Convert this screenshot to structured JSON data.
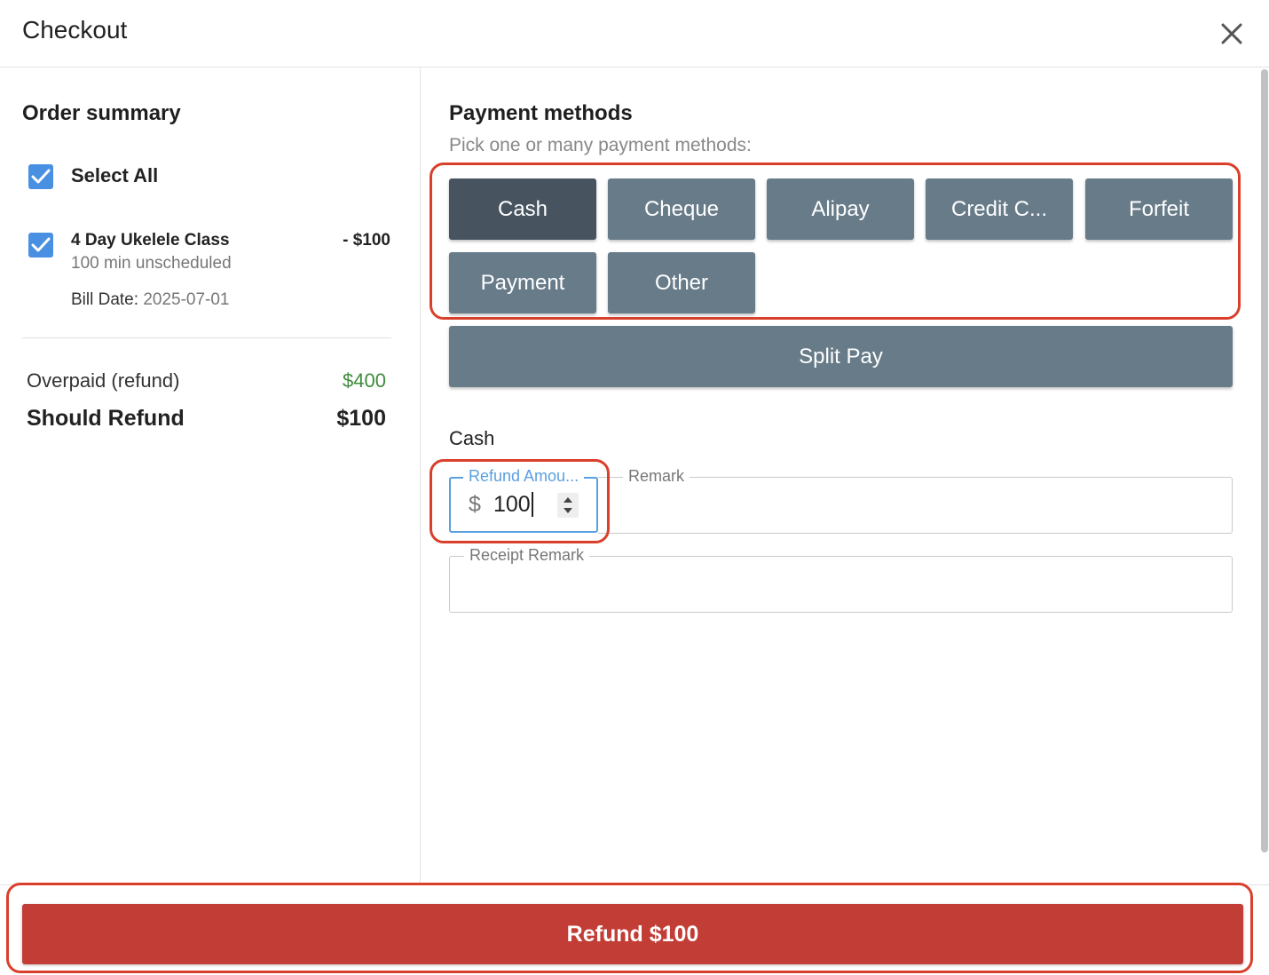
{
  "header": {
    "title": "Checkout"
  },
  "order_summary": {
    "title": "Order summary",
    "select_all_label": "Select All",
    "items": [
      {
        "name": "4 Day Ukelele Class",
        "price": "- $100",
        "sub": "100 min unscheduled",
        "bill_date_label": "Bill Date:",
        "bill_date_value": "2025-07-01"
      }
    ],
    "overpaid_label": "Overpaid (refund)",
    "overpaid_value": "$400",
    "should_refund_label": "Should Refund",
    "should_refund_value": "$100"
  },
  "payment": {
    "title": "Payment methods",
    "subtitle": "Pick one or many payment methods:",
    "methods": [
      {
        "label": "Cash",
        "selected": true
      },
      {
        "label": "Cheque",
        "selected": false
      },
      {
        "label": "Alipay",
        "selected": false
      },
      {
        "label": "Credit C...",
        "selected": false
      },
      {
        "label": "Forfeit",
        "selected": false
      },
      {
        "label": "Payment",
        "selected": false
      },
      {
        "label": "Other",
        "selected": false
      }
    ],
    "split_pay_label": "Split Pay",
    "method_section_label": "Cash",
    "refund_amount_label": "Refund Amou...",
    "currency_symbol": "$",
    "refund_amount_value": "100",
    "remark_label": "Remark",
    "receipt_remark_label": "Receipt Remark"
  },
  "footer": {
    "refund_button_label": "Refund $100"
  },
  "colors": {
    "method_button": "#677b89",
    "method_button_selected": "#47545f",
    "refund_button": "#c23d36",
    "checkbox": "#4a90e2",
    "overpaid_value": "#3d8b3d",
    "highlight": "#d9402c"
  }
}
